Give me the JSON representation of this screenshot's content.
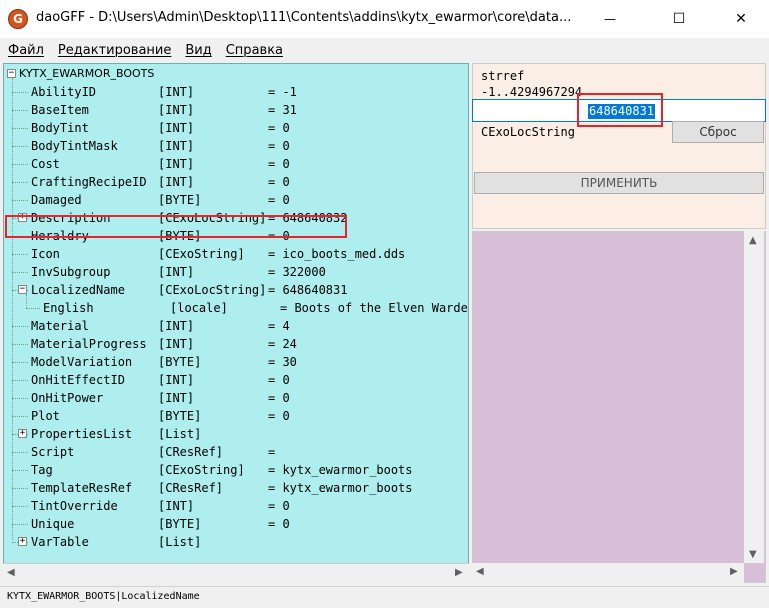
{
  "window": {
    "title": "daoGFF - D:\\Users\\Admin\\Desktop\\111\\Contents\\addins\\kytx_ewarmor\\core\\data...",
    "icon": "g-app-icon",
    "minimize_glyph": "—",
    "maximize_glyph": "☐",
    "close_glyph": "✕"
  },
  "menu": [
    {
      "label": "Файл"
    },
    {
      "label": "Редактирование"
    },
    {
      "label": "Вид"
    },
    {
      "label": "Справка"
    }
  ],
  "tree": {
    "root": "KYTX_EWARMOR_BOOTS",
    "rows": [
      {
        "name": "AbilityID",
        "type": "[INT]",
        "value": "= -1"
      },
      {
        "name": "BaseItem",
        "type": "[INT]",
        "value": "= 31"
      },
      {
        "name": "BodyTint",
        "type": "[INT]",
        "value": "= 0"
      },
      {
        "name": "BodyTintMask",
        "type": "[INT]",
        "value": "= 0"
      },
      {
        "name": "Cost",
        "type": "[INT]",
        "value": "= 0"
      },
      {
        "name": "CraftingRecipeID",
        "type": "[INT]",
        "value": "= 0"
      },
      {
        "name": "Damaged",
        "type": "[BYTE]",
        "value": "= 0"
      },
      {
        "name": "Description",
        "type": "[CExoLocString]",
        "value": "= 648640832",
        "expander": "+"
      },
      {
        "name": "Heraldry",
        "type": "[BYTE]",
        "value": "= 0"
      },
      {
        "name": "Icon",
        "type": "[CExoString]",
        "value": "= ico_boots_med.dds"
      },
      {
        "name": "InvSubgroup",
        "type": "[INT]",
        "value": "= 322000"
      },
      {
        "name": "LocalizedName",
        "type": "[CExoLocString]",
        "value": "= 648640831",
        "expander": "−"
      },
      {
        "name": "English",
        "type": "[locale]",
        "value": "= Boots of the Elven Warden",
        "child": true
      },
      {
        "name": "Material",
        "type": "[INT]",
        "value": "= 4"
      },
      {
        "name": "MaterialProgress",
        "type": "[INT]",
        "value": "= 24"
      },
      {
        "name": "ModelVariation",
        "type": "[BYTE]",
        "value": "= 30"
      },
      {
        "name": "OnHitEffectID",
        "type": "[INT]",
        "value": "= 0"
      },
      {
        "name": "OnHitPower",
        "type": "[INT]",
        "value": "= 0"
      },
      {
        "name": "Plot",
        "type": "[BYTE]",
        "value": "= 0"
      },
      {
        "name": "PropertiesList",
        "type": "[List]",
        "value": "",
        "expander": "+"
      },
      {
        "name": "Script",
        "type": "[CResRef]",
        "value": "="
      },
      {
        "name": "Tag",
        "type": "[CExoString]",
        "value": "= kytx_ewarmor_boots"
      },
      {
        "name": "TemplateResRef",
        "type": "[CResRef]",
        "value": "= kytx_ewarmor_boots"
      },
      {
        "name": "TintOverride",
        "type": "[INT]",
        "value": "= 0"
      },
      {
        "name": "Unique",
        "type": "[BYTE]",
        "value": "= 0"
      },
      {
        "name": "VarTable",
        "type": "[List]",
        "value": "",
        "expander": "+"
      }
    ]
  },
  "editor": {
    "field_label": "strref",
    "range_label": "-1..4294967294",
    "value": "648640831",
    "type_label": "CExoLocString",
    "reset_button": "Сброс",
    "apply_button": "ПРИМЕНИТЬ"
  },
  "status": {
    "path": "KYTX_EWARMOR_BOOTS|LocalizedName"
  },
  "colors": {
    "tree_bg": "#aeeeee",
    "editor_bg": "#fbeee5",
    "lower_bg": "#d8bfd8",
    "highlight": "#e8232b",
    "selection": "#0078d7"
  }
}
